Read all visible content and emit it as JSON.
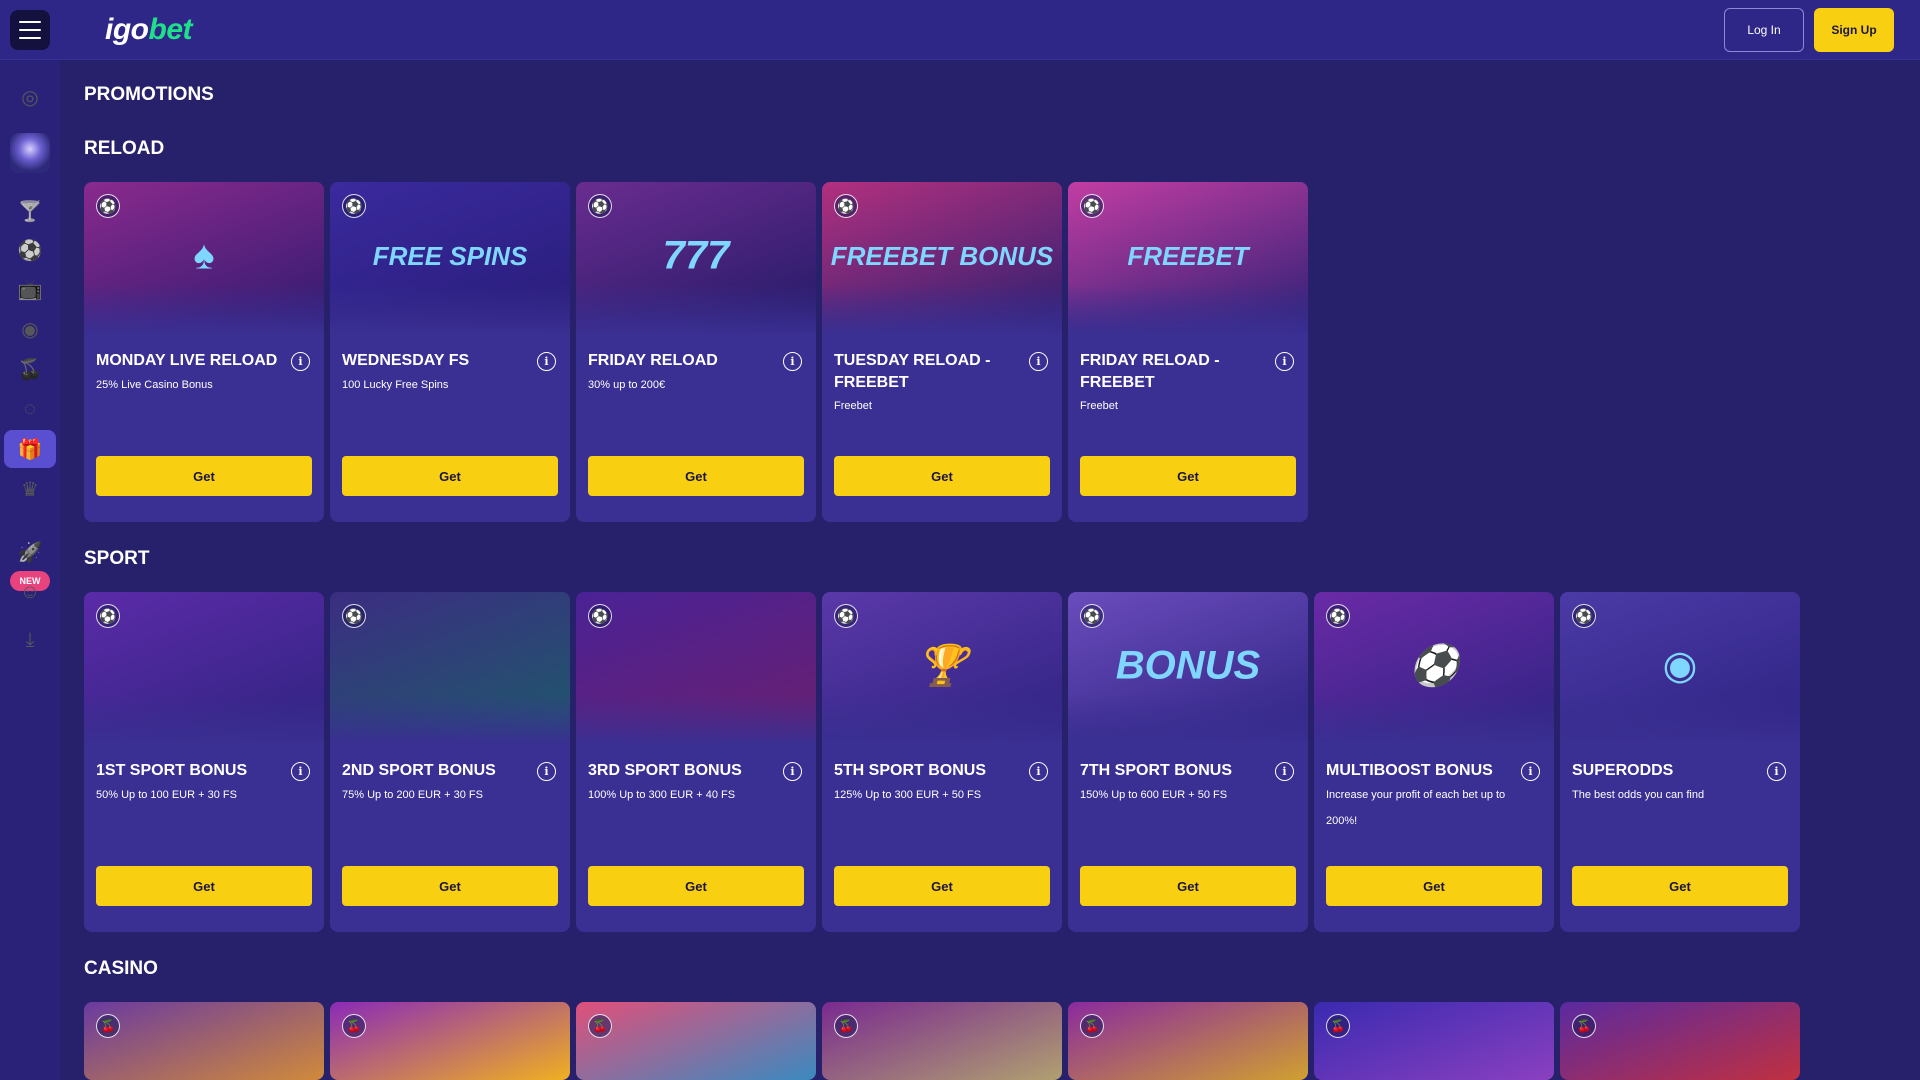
{
  "header": {
    "logo_part1": "igo",
    "logo_part2": "bet",
    "login_label": "Log In",
    "signup_label": "Sign Up"
  },
  "sidebar": {
    "new_badge": "NEW",
    "items": [
      {
        "icon": "target-icon",
        "glyph": "◎"
      },
      {
        "icon": "avatar-icon",
        "glyph": ""
      },
      {
        "icon": "goblet-icon",
        "glyph": "🍸"
      },
      {
        "icon": "soccer-ball-icon",
        "glyph": "⚽"
      },
      {
        "icon": "live-tv-icon",
        "glyph": "📺"
      },
      {
        "icon": "chip-icon",
        "glyph": "◉"
      },
      {
        "icon": "cherries-icon",
        "glyph": "🍒"
      },
      {
        "icon": "roulette-icon",
        "glyph": "◌"
      },
      {
        "icon": "gift-icon",
        "glyph": "🎁"
      },
      {
        "icon": "crown-icon",
        "glyph": "♛"
      },
      {
        "icon": "rocket-icon",
        "glyph": "🚀"
      },
      {
        "icon": "support-agent-icon",
        "glyph": "☺"
      },
      {
        "icon": "download-icon",
        "glyph": "⤓"
      }
    ]
  },
  "page_title": "PROMOTIONS",
  "sections": [
    {
      "title": "RELOAD",
      "cards": [
        {
          "title": "MONDAY LIVE RELOAD",
          "desc": "25% Live Casino Bonus",
          "button": "Get",
          "art": "♠",
          "bg": [
            "#8a2a8e",
            "#2e1a6e"
          ]
        },
        {
          "title": "WEDNESDAY FS",
          "desc": "100 Lucky Free Spins",
          "button": "Get",
          "art": "FREE SPINS",
          "bg": [
            "#3a2a9e",
            "#281c78"
          ]
        },
        {
          "title": "FRIDAY RELOAD",
          "desc": "30% up to 200€",
          "button": "Get",
          "art": "777",
          "bg": [
            "#6a2c90",
            "#221a66"
          ]
        },
        {
          "title": "TUESDAY RELOAD - FREEBET",
          "desc": "Freebet",
          "button": "Get",
          "art": "FREEBET BONUS",
          "bg": [
            "#b2307f",
            "#2a1f70"
          ]
        },
        {
          "title": "FRIDAY RELOAD - FREEBET",
          "desc": "Freebet",
          "button": "Get",
          "art": "FREEBET",
          "bg": [
            "#c23da3",
            "#2a2074"
          ]
        }
      ]
    },
    {
      "title": "SPORT",
      "cards": [
        {
          "title": "1ST SPORT BONUS",
          "desc": "50% Up to 100 EUR + 30 FS",
          "button": "Get",
          "art": "",
          "bg": [
            "#5b2ba8",
            "#2f2380"
          ]
        },
        {
          "title": "2ND SPORT BONUS",
          "desc": "75% Up to 200 EUR + 30 FS",
          "button": "Get",
          "art": "",
          "bg": [
            "#3b2d82",
            "#1e5a6a"
          ]
        },
        {
          "title": "3RD SPORT BONUS",
          "desc": "100% Up to 300 EUR + 40 FS",
          "button": "Get",
          "art": "",
          "bg": [
            "#4a2296",
            "#6a1f6e"
          ]
        },
        {
          "title": "5TH SPORT BONUS",
          "desc": "125% Up to 300 EUR + 50 FS",
          "button": "Get",
          "art": "🏆",
          "bg": [
            "#5a38a8",
            "#2e2382"
          ]
        },
        {
          "title": "7TH SPORT BONUS",
          "desc": "150% Up to 600 EUR + 50 FS",
          "button": "Get",
          "art": "BONUS",
          "bg": [
            "#6a4cbc",
            "#2e2382"
          ]
        },
        {
          "title": "MULTIBOOST BONUS",
          "desc": "Increase your profit of each bet up to 200%!",
          "button": "Get",
          "art": "⚽",
          "bg": [
            "#6a2aa6",
            "#2e2382"
          ]
        },
        {
          "title": "SUPERODDS",
          "desc": "The best odds you can find",
          "button": "Get",
          "art": "◉",
          "bg": [
            "#4a3aa6",
            "#2e2382"
          ]
        }
      ]
    },
    {
      "title": "CASINO"
    }
  ],
  "casino_cards": [
    {
      "bg": [
        "#6a3aa0",
        "#d08a3a"
      ]
    },
    {
      "bg": [
        "#8a2ab8",
        "#f0b020"
      ]
    },
    {
      "bg": [
        "#e0507a",
        "#3a8ac0"
      ]
    },
    {
      "bg": [
        "#7a2a90",
        "#b0a070"
      ]
    },
    {
      "bg": [
        "#8a2a9e",
        "#d0a030"
      ]
    },
    {
      "bg": [
        "#3a2ab0",
        "#8a40c0"
      ]
    },
    {
      "bg": [
        "#5a2aa0",
        "#c03040"
      ]
    }
  ]
}
